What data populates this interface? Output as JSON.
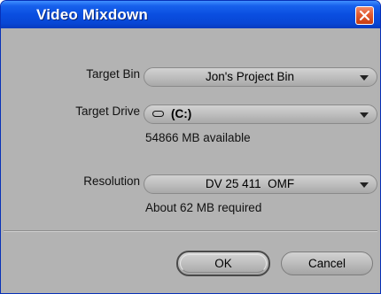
{
  "window": {
    "title": "Video Mixdown"
  },
  "fields": {
    "target_bin": {
      "label": "Target Bin",
      "value": "Jon's Project Bin"
    },
    "target_drive": {
      "label": "Target Drive",
      "value": "(C:)",
      "icon": "drive-icon",
      "info": "54866 MB available"
    },
    "resolution": {
      "label": "Resolution",
      "value": "DV 25 411  OMF",
      "info": "About 62 MB required"
    }
  },
  "buttons": {
    "ok_label": "OK",
    "cancel_label": "Cancel"
  },
  "colors": {
    "titlebar": "#0a4ee0",
    "close": "#e25a2e",
    "dialog_bg": "#b3b3b3"
  }
}
